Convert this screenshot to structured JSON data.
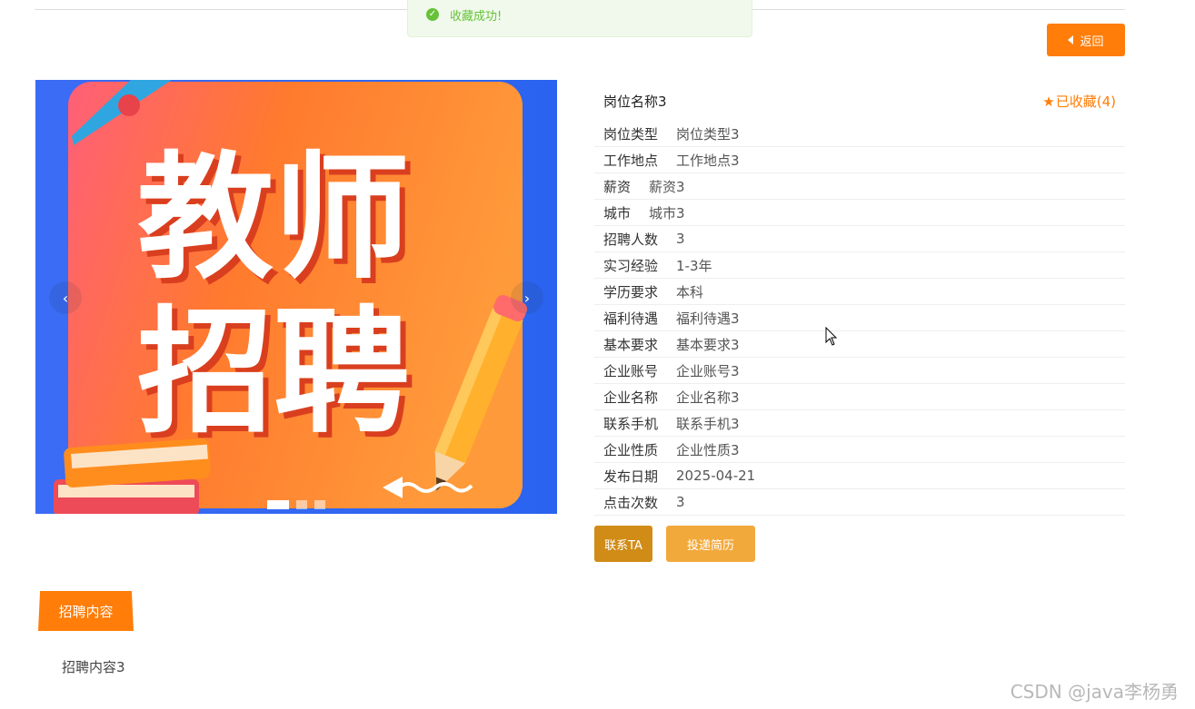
{
  "toast": {
    "icon": "check-circle-icon",
    "message": "收藏成功!"
  },
  "back_button": {
    "icon": "caret-left-icon",
    "label": "返回"
  },
  "carousel": {
    "poster_line1": "教师",
    "poster_line2": "招聘",
    "prev_icon": "chevron-left-icon",
    "next_icon": "chevron-right-icon",
    "slide_count": 3,
    "active_slide": 1
  },
  "job": {
    "title": "岗位名称3",
    "favorite_icon": "star-icon",
    "favorite_label": "已收藏(4)",
    "fields": [
      {
        "label": "岗位类型",
        "value": "岗位类型3"
      },
      {
        "label": "工作地点",
        "value": "工作地点3"
      },
      {
        "label": "薪资",
        "value": "薪资3"
      },
      {
        "label": "城市",
        "value": "城市3"
      },
      {
        "label": "招聘人数",
        "value": "3"
      },
      {
        "label": "实习经验",
        "value": "1-3年"
      },
      {
        "label": "学历要求",
        "value": "本科"
      },
      {
        "label": "福利待遇",
        "value": "福利待遇3"
      },
      {
        "label": "基本要求",
        "value": "基本要求3"
      },
      {
        "label": "企业账号",
        "value": "企业账号3"
      },
      {
        "label": "企业名称",
        "value": "企业名称3"
      },
      {
        "label": "联系手机",
        "value": "联系手机3"
      },
      {
        "label": "企业性质",
        "value": "企业性质3"
      },
      {
        "label": "发布日期",
        "value": "2025-04-21"
      },
      {
        "label": "点击次数",
        "value": "3"
      }
    ]
  },
  "actions": {
    "contact_label": "联系TA",
    "resume_label": "投递简历"
  },
  "content_tab": {
    "label": "招聘内容",
    "body": "招聘内容3"
  },
  "watermark": "CSDN @java李杨勇",
  "colors": {
    "accent": "#ff7d08",
    "contact": "#d08c17",
    "resume": "#f2a93b",
    "success": "#67c23a"
  }
}
